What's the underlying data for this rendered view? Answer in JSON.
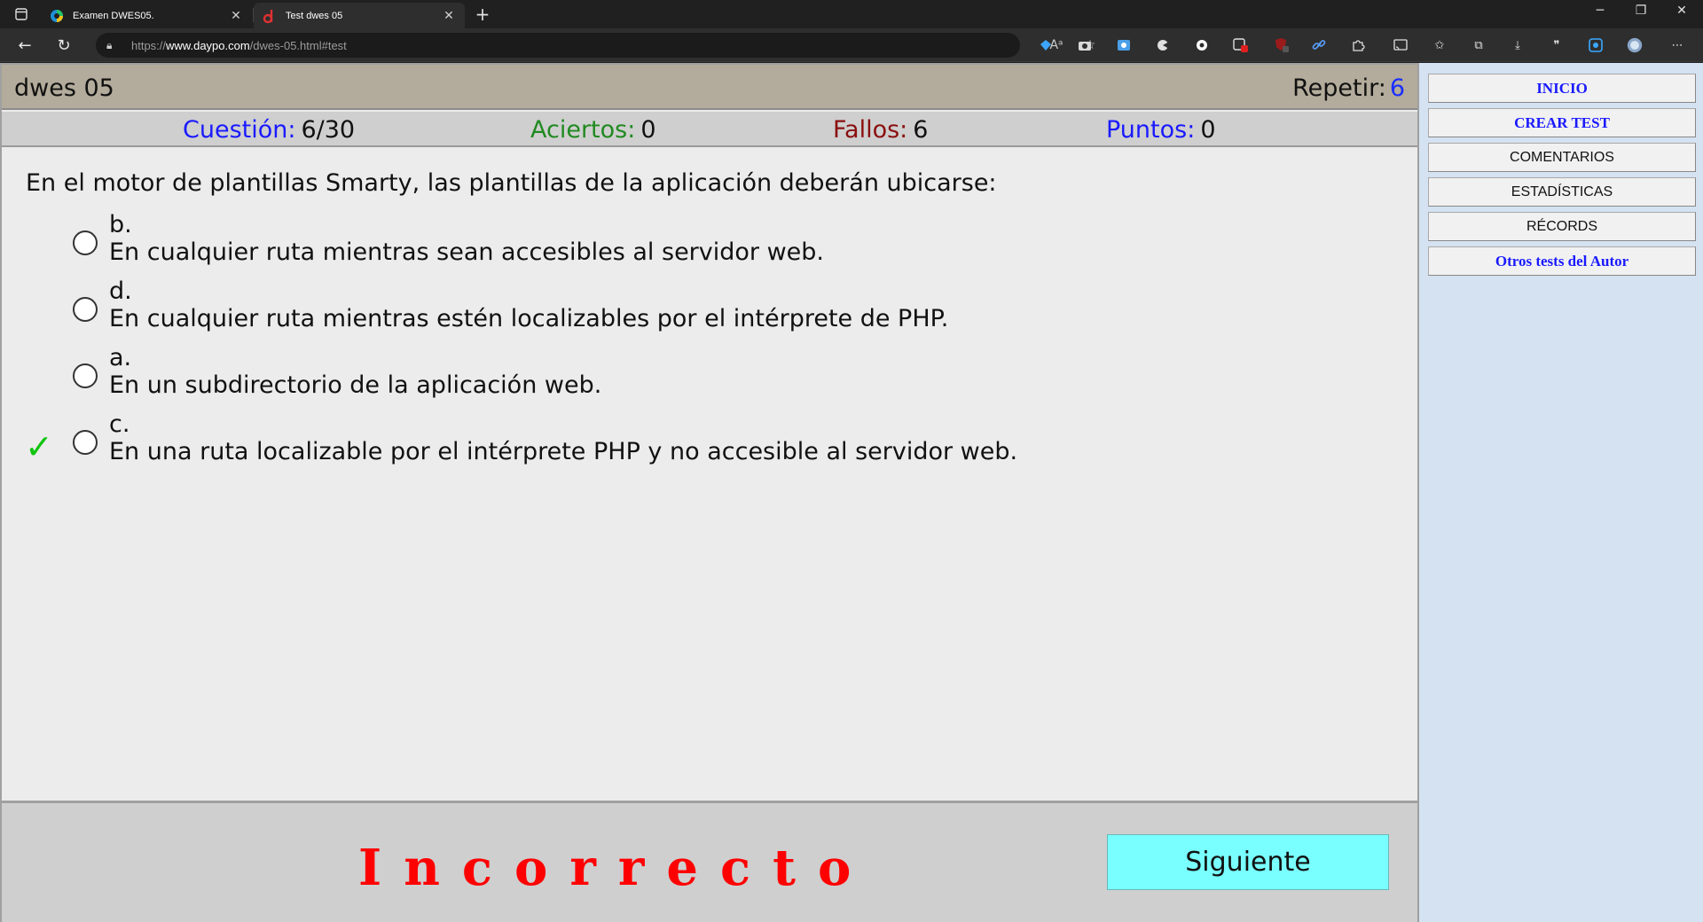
{
  "browser": {
    "tabs": [
      {
        "title": "Examen DWES05.",
        "active": false
      },
      {
        "title": "Test dwes 05",
        "active": true
      }
    ],
    "url_prefix": "https://",
    "url_host": "www.daypo.com",
    "url_path": "/dwes-05.html#test"
  },
  "quiz": {
    "title": "dwes 05",
    "repeat_label": "Repetir:",
    "repeat_value": "6",
    "stats": {
      "question_label": "Cuestión:",
      "question_value": "6/30",
      "hits_label": "Aciertos:",
      "hits_value": "0",
      "fails_label": "Fallos:",
      "fails_value": "6",
      "points_label": "Puntos:",
      "points_value": "0"
    },
    "question": "En el motor de plantillas Smarty, las plantillas de la aplicación deberán ubicarse:",
    "options": [
      {
        "letter": "b.",
        "text": "En cualquier ruta mientras sean accesibles al servidor web."
      },
      {
        "letter": "d.",
        "text": "En cualquier ruta mientras estén localizables por el intérprete de PHP."
      },
      {
        "letter": "a.",
        "text": "En un subdirectorio de la aplicación web."
      },
      {
        "letter": "c.",
        "text": "En una ruta localizable por el intérprete PHP y no accesible al servidor web.",
        "correct_mark": "✓"
      }
    ],
    "result": "Incorrecto",
    "next_label": "Siguiente"
  },
  "sidebar": {
    "buttons": [
      "INICIO",
      "CREAR TEST",
      "COMENTARIOS",
      "ESTADÍSTICAS",
      "RÉCORDS",
      "Otros tests del Autor"
    ]
  },
  "colors": {
    "result": "#ff0000",
    "next_button": "#79ffff",
    "check": "#11c411"
  }
}
